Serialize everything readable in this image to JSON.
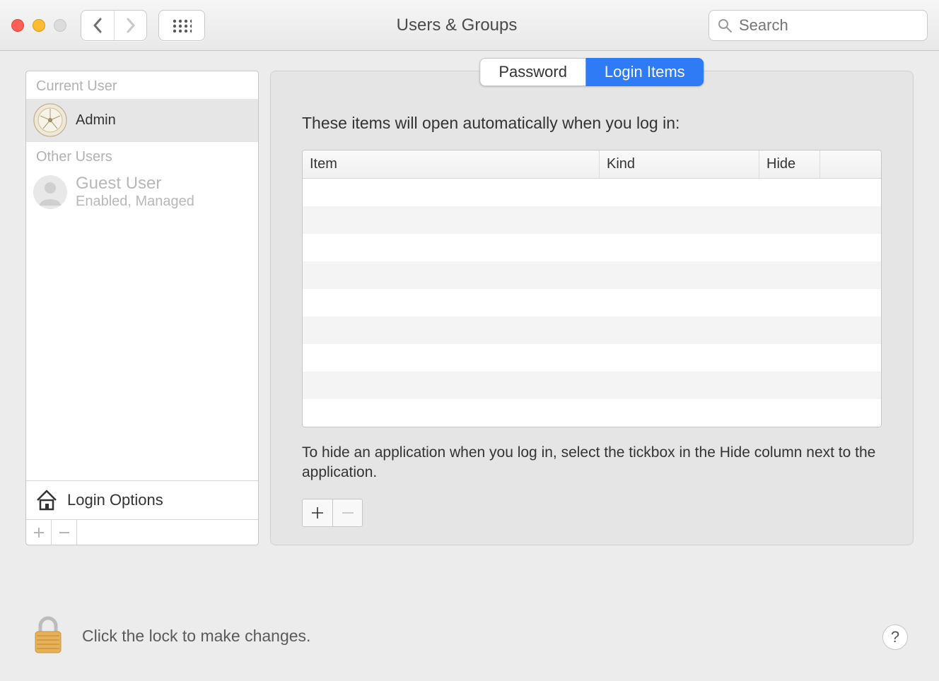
{
  "window": {
    "title": "Users & Groups"
  },
  "search": {
    "placeholder": "Search",
    "value": ""
  },
  "sidebar": {
    "current_user_header": "Current User",
    "other_users_header": "Other Users",
    "current_user": {
      "name": "",
      "role": "Admin"
    },
    "guest_user": {
      "name": "Guest User",
      "status": "Enabled, Managed"
    },
    "login_options_label": "Login Options"
  },
  "tabs": {
    "password": "Password",
    "login_items": "Login Items",
    "active": "login_items"
  },
  "main": {
    "intro": "These items will open automatically when you log in:",
    "columns": {
      "item": "Item",
      "kind": "Kind",
      "hide": "Hide"
    },
    "rows": [],
    "hint": "To hide an application when you log in, select the tickbox in the Hide column next to the application."
  },
  "footer": {
    "lock_text": "Click the lock to make changes."
  }
}
